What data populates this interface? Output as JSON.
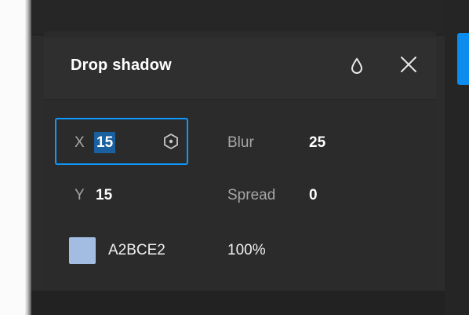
{
  "panel": {
    "title": "Drop shadow",
    "icons": {
      "visibility": "drop-icon",
      "close": "close-icon"
    }
  },
  "shadow": {
    "x_label": "X",
    "x_value": "15",
    "y_label": "Y",
    "y_value": "15",
    "blur_label": "Blur",
    "blur_value": "25",
    "spread_label": "Spread",
    "spread_value": "0",
    "color_hex": "A2BCE2",
    "opacity": "100%"
  },
  "colors": {
    "accent": "#0d99ff",
    "swatch": "#a2bce2"
  }
}
